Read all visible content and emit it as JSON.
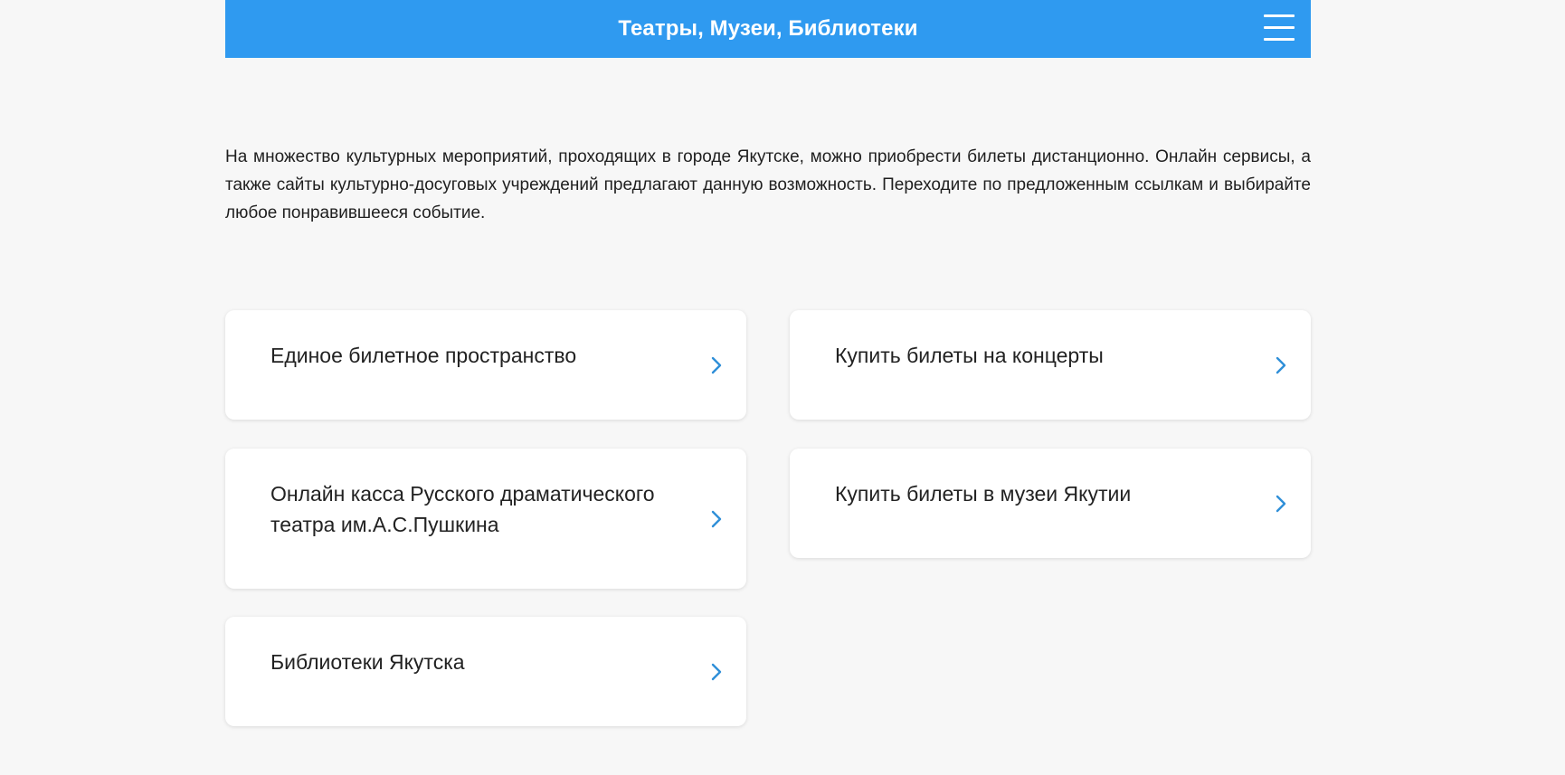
{
  "header": {
    "title": "Театры, Музеи, Библиотеки",
    "background_color": "#2f9af0",
    "menu_icon": "hamburger-menu-icon"
  },
  "intro": {
    "text": "На множество культурных мероприятий, проходящих в городе Якутске, можно приобрести билеты дистанционно. Онлайн сервисы, а также сайты культурно-досуговых учреждений предлагают данную возможность. Переходите по предложенным ссылкам и выбирайте любое понравившееся событие."
  },
  "cards": [
    {
      "label": "Единое билетное пространство",
      "icon": "chevron-right-icon"
    },
    {
      "label": "Купить билеты на концерты",
      "icon": "chevron-right-icon"
    },
    {
      "label": "Онлайн касса Русского драматического театра им.А.С.Пушкина",
      "icon": "chevron-right-icon"
    },
    {
      "label": "Купить билеты в музеи Якутии",
      "icon": "chevron-right-icon"
    },
    {
      "label": "Библиотеки Якутска",
      "icon": "chevron-right-icon"
    }
  ],
  "colors": {
    "accent": "#2f9af0",
    "chevron": "#2f8fd8",
    "page_background": "#f7f7f7",
    "card_background": "#ffffff"
  }
}
